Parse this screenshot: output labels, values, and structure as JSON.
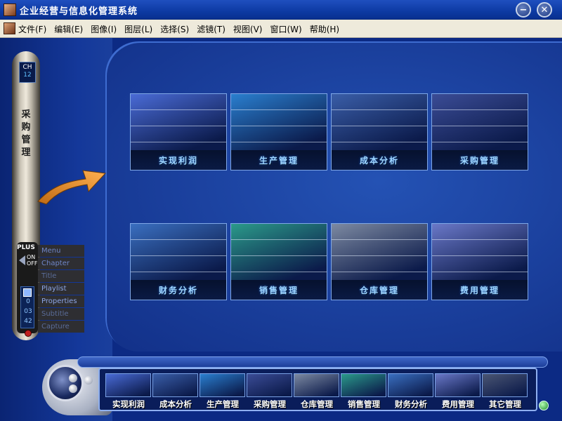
{
  "window": {
    "title": "企业经营与信息化管理系统",
    "minimize_icon": "minimize-icon",
    "close_icon": "close-icon",
    "minimize_symbol": "−",
    "close_symbol": "✕"
  },
  "menubar": {
    "items": [
      {
        "label": "文件(F)"
      },
      {
        "label": "编辑(E)"
      },
      {
        "label": "图像(I)"
      },
      {
        "label": "图层(L)"
      },
      {
        "label": "选择(S)"
      },
      {
        "label": "滤镜(T)"
      },
      {
        "label": "视图(V)"
      },
      {
        "label": "窗口(W)"
      },
      {
        "label": "帮助(H)"
      }
    ]
  },
  "grid": {
    "tiles": [
      {
        "label": "实现利润",
        "color": "#4a6bd6"
      },
      {
        "label": "生产管理",
        "color": "#2a7fcf"
      },
      {
        "label": "成本分析",
        "color": "#3a5ea8"
      },
      {
        "label": "采购管理",
        "color": "#3b4c96"
      },
      {
        "label": "财务分析",
        "color": "#3a6fc0"
      },
      {
        "label": "销售管理",
        "color": "#2b9a8a"
      },
      {
        "label": "仓库管理",
        "color": "#7d8aa2"
      },
      {
        "label": "费用管理",
        "color": "#6a78c8"
      }
    ]
  },
  "remote": {
    "ch_label": "CH",
    "ch_number": "12",
    "section_label": "采\n购\n管\n理",
    "plus_label": "PLUS",
    "on_label": "ON",
    "off_label": "OFF",
    "counter": [
      "0",
      "03",
      "42"
    ],
    "menu": [
      {
        "label": "Menu"
      },
      {
        "label": "Chapter"
      },
      {
        "label": "Title"
      },
      {
        "label": "Playlist"
      },
      {
        "label": "Properties"
      },
      {
        "label": "Subtitle"
      },
      {
        "label": "Capture"
      }
    ]
  },
  "bottom_bar": {
    "items": [
      {
        "label": "实现利润",
        "color": "#4a6bd6"
      },
      {
        "label": "成本分析",
        "color": "#3a5ea8"
      },
      {
        "label": "生产管理",
        "color": "#2a7fcf"
      },
      {
        "label": "采购管理",
        "color": "#3b4c96"
      },
      {
        "label": "仓库管理",
        "color": "#7d8aa2"
      },
      {
        "label": "销售管理",
        "color": "#2b9a8a"
      },
      {
        "label": "财务分析",
        "color": "#3a6fc0"
      },
      {
        "label": "费用管理",
        "color": "#6a78c8"
      },
      {
        "label": "其它管理",
        "color": "#4b5673"
      }
    ]
  },
  "colors": {
    "accent_arrow": "#e8902a",
    "panel_blue": "#1a3f9c",
    "caption_text": "#9fd6ff"
  }
}
